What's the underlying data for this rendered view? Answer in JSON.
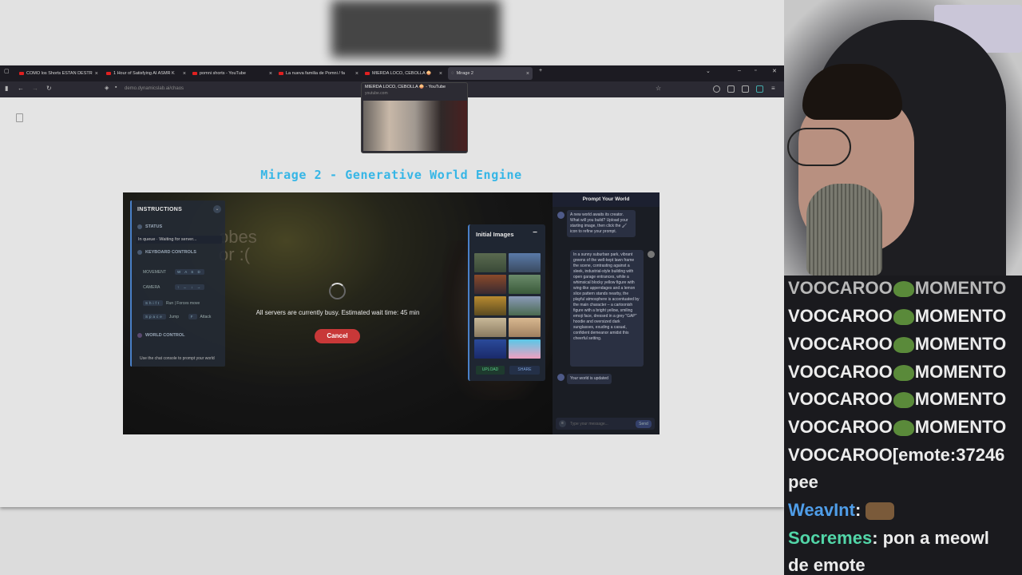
{
  "browser": {
    "tabs": [
      {
        "title": "COMO los Shorts ESTAN DESTR"
      },
      {
        "title": "1 Hour of Satisfying AI ASMR K"
      },
      {
        "title": "pomni shorts - YouTube"
      },
      {
        "title": "La nueva familia de Pomni / fa"
      },
      {
        "title": "MIERDA LOCO, CEBOLLA 🧅"
      },
      {
        "title": "Mirage 2"
      }
    ],
    "new_tab_label": "+",
    "url": "demo.dynamicslab.ai/chaos",
    "tooltip": {
      "title": "MIERDA LOCO, CEBOLLA 🧅 - YouTube",
      "domain": "youtube.com"
    }
  },
  "page": {
    "title": "Mirage 2 - Generative World Engine",
    "instructions": {
      "header": "INSTRUCTIONS",
      "status_label": "STATUS",
      "status_value": "In queue · Waiting for server...",
      "keyboard_label": "KEYBOARD CONTROLS",
      "movement_label": "MOVEMENT",
      "movement_keys": "W A S D",
      "camera_label": "CAMERA",
      "camera_keys": "↑ ← ↓ →",
      "run_key": "Shift",
      "run_text": "Run | Forces move",
      "jump_key": "Space",
      "jump_text": "Jump",
      "attack_key": "F",
      "attack_text": "Attack",
      "world_control_label": "WORLD CONTROL",
      "world_control_text": "Use the chat console to prompt your world"
    },
    "busy_message": "All servers are currently busy. Estimated wait time: 45 min",
    "cancel_label": "Cancel",
    "initial_images": {
      "header": "Initial Images",
      "collapse": "−",
      "upload_label": "UPLOAD",
      "share_label": "SHARE"
    },
    "chat": {
      "header": "Prompt Your World",
      "messages": [
        {
          "text": "A new world awaits its creator. What will you build? Upload your starting image, then click the 🖌 icon to refine your prompt."
        },
        {
          "text": "In a sunny suburban park, vibrant greens of the well-kept lawn frame the scene, contrasting against a sleek, industrial-style building with open garage entrances, while a whimsical blocky yellow figure with wing-like appendages and a lemon slice pattern stands nearby, the playful atmosphere is accentuated by the main character – a cartoonish figure with a bright yellow, smiling emoji face, dressed in a grey \"GAP\" hoodie and oversized dark sunglasses, exuding a casual, confident demeanor amidst this cheerful setting."
        },
        {
          "text": "Your world is updated"
        }
      ],
      "placeholder": "Type your message...",
      "send_label": "Send"
    },
    "bg_text": "obes\nor :("
  },
  "stream_chat": {
    "lines": [
      {
        "user": "",
        "text": "VOOCAROO",
        "tail": "MOMENTO"
      },
      {
        "user": "",
        "text": "VOOCAROO",
        "tail": "MOMENTO"
      },
      {
        "user": "",
        "text": "VOOCAROO",
        "tail": "MOMENTO"
      },
      {
        "user": "",
        "text": "VOOCAROO",
        "tail": "MOMENTO"
      },
      {
        "user": "",
        "text": "VOOCAROO",
        "tail": "MOMENTO"
      },
      {
        "user": "",
        "text": "VOOCAROO",
        "tail": "MOMENTO"
      },
      {
        "user": "",
        "text": "VOOCAROO[emote:37246",
        "tail": ""
      }
    ],
    "pee": "pee",
    "weavint_user": "WeavInt",
    "weavint_sep": ":",
    "socremes_user": "Socremes",
    "socremes_sep": ":",
    "socremes_text1": "pon a meowl",
    "socremes_text2": "de emote",
    "colors": {
      "weavint": "#4f9de8",
      "socremes": "#52d6a8"
    }
  }
}
